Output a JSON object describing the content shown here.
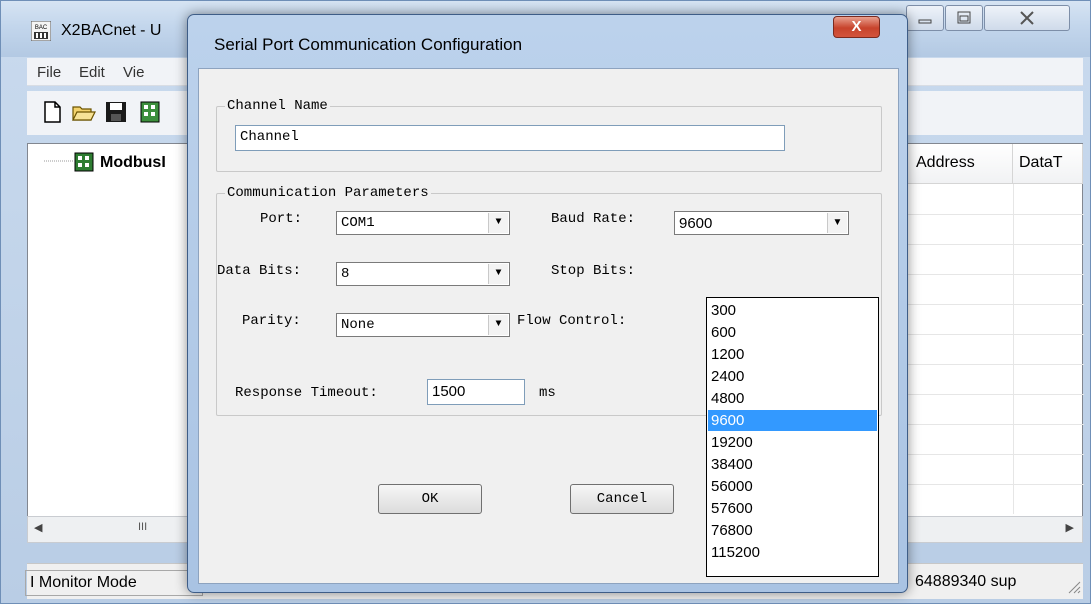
{
  "main_window": {
    "title": "X2BACnet - U",
    "icon_text": "BAC",
    "menu": [
      "File",
      "Edit",
      "Vie"
    ],
    "tree_root": "ModbusI",
    "grid_columns": [
      "Address",
      "DataT"
    ],
    "status_left": "Monitor Mode",
    "status_right": "64889340 sup",
    "status_prefix": "I",
    "scroll_mark": "III"
  },
  "dialog": {
    "title": "Serial Port Communication Configuration",
    "close_glyph": "X",
    "channel_group": {
      "label": "Channel Name",
      "value": "Channel"
    },
    "comm_group": {
      "label": "Communication Parameters",
      "port_label": "Port:",
      "port_value": "COM1",
      "baud_label": "Baud Rate:",
      "baud_value": "9600",
      "databits_label": "Data Bits:",
      "databits_value": "8",
      "stopbits_label": "Stop Bits:",
      "parity_label": "Parity:",
      "parity_value": "None",
      "flow_label": "Flow Control:",
      "timeout_label": "Response Timeout:",
      "timeout_value": "1500",
      "timeout_unit": "ms"
    },
    "ok_label": "OK",
    "cancel_label": "Cancel",
    "baud_options": [
      "300",
      "600",
      "1200",
      "2400",
      "4800",
      "9600",
      "19200",
      "38400",
      "56000",
      "57600",
      "76800",
      "115200"
    ],
    "baud_selected": "9600"
  },
  "colors": {
    "selection": "#3399ff",
    "close_button": "#c7432c"
  }
}
